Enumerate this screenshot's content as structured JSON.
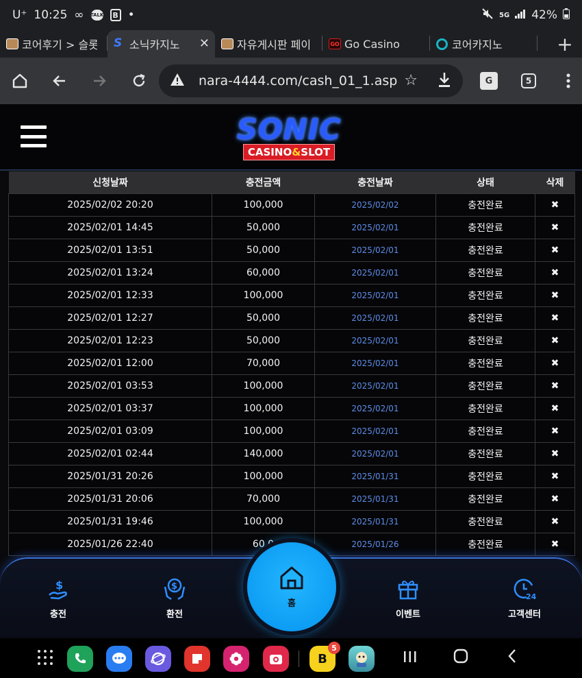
{
  "status_bar": {
    "carrier": "U⁺",
    "time": "10:25",
    "dot": "•",
    "battery": "42%",
    "network": "5G",
    "talk_badge": "TALK",
    "b_badge": "B"
  },
  "tabs": [
    {
      "title": "코어후기 > 슬롯",
      "favicon": "slot-icon"
    },
    {
      "title": "소닉카지노",
      "favicon": "sonic-s-icon",
      "active": true
    },
    {
      "title": "자유게시판 페이",
      "favicon": "slot-icon"
    },
    {
      "title": "Go Casino",
      "favicon": "go-icon"
    },
    {
      "title": "코어카지노",
      "favicon": "ring-icon"
    }
  ],
  "favicon_text": {
    "s": "S",
    "go": "GO"
  },
  "toolbar": {
    "url": "nara-4444.com/cash_01_1.asp",
    "tab_count": "5",
    "translate_label": "G"
  },
  "logo": {
    "title": "SONIC",
    "sub_left": "CASINO",
    "sub_amp": "&",
    "sub_right": "SLOT"
  },
  "table": {
    "headers": [
      "신청날짜",
      "충전금액",
      "충전날짜",
      "상태",
      "삭제"
    ],
    "rows": [
      {
        "req": "2025/02/02 20:20",
        "amount": "100,000",
        "date": "2025/02/02",
        "status": "충전완료",
        "del": "✖"
      },
      {
        "req": "2025/02/01 14:45",
        "amount": "50,000",
        "date": "2025/02/01",
        "status": "충전완료",
        "del": "✖"
      },
      {
        "req": "2025/02/01 13:51",
        "amount": "50,000",
        "date": "2025/02/01",
        "status": "충전완료",
        "del": "✖"
      },
      {
        "req": "2025/02/01 13:24",
        "amount": "60,000",
        "date": "2025/02/01",
        "status": "충전완료",
        "del": "✖"
      },
      {
        "req": "2025/02/01 12:33",
        "amount": "100,000",
        "date": "2025/02/01",
        "status": "충전완료",
        "del": "✖"
      },
      {
        "req": "2025/02/01 12:27",
        "amount": "50,000",
        "date": "2025/02/01",
        "status": "충전완료",
        "del": "✖"
      },
      {
        "req": "2025/02/01 12:23",
        "amount": "50,000",
        "date": "2025/02/01",
        "status": "충전완료",
        "del": "✖"
      },
      {
        "req": "2025/02/01 12:00",
        "amount": "70,000",
        "date": "2025/02/01",
        "status": "충전완료",
        "del": "✖"
      },
      {
        "req": "2025/02/01 03:53",
        "amount": "100,000",
        "date": "2025/02/01",
        "status": "충전완료",
        "del": "✖"
      },
      {
        "req": "2025/02/01 03:37",
        "amount": "100,000",
        "date": "2025/02/01",
        "status": "충전완료",
        "del": "✖"
      },
      {
        "req": "2025/02/01 03:09",
        "amount": "100,000",
        "date": "2025/02/01",
        "status": "충전완료",
        "del": "✖"
      },
      {
        "req": "2025/02/01 02:44",
        "amount": "140,000",
        "date": "2025/02/01",
        "status": "충전완료",
        "del": "✖"
      },
      {
        "req": "2025/01/31 20:26",
        "amount": "100,000",
        "date": "2025/01/31",
        "status": "충전완료",
        "del": "✖"
      },
      {
        "req": "2025/01/31 20:06",
        "amount": "70,000",
        "date": "2025/01/31",
        "status": "충전완료",
        "del": "✖"
      },
      {
        "req": "2025/01/31 19:46",
        "amount": "100,000",
        "date": "2025/01/31",
        "status": "충전완료",
        "del": "✖"
      },
      {
        "req": "2025/01/26 22:40",
        "amount": "60,0",
        "date": "2025/01/26",
        "status": "충전완료",
        "del": "✖"
      }
    ]
  },
  "bottom_nav": {
    "charge": "충전",
    "exchange": "환전",
    "home": "홈",
    "event": "이벤트",
    "support": "고객센터"
  },
  "dock": {
    "notif_count": "5",
    "b_app": "B"
  },
  "colors": {
    "accent_blue": "#1aa4ff",
    "date_link": "#5d8ee8",
    "logo_red": "#d91c25"
  }
}
